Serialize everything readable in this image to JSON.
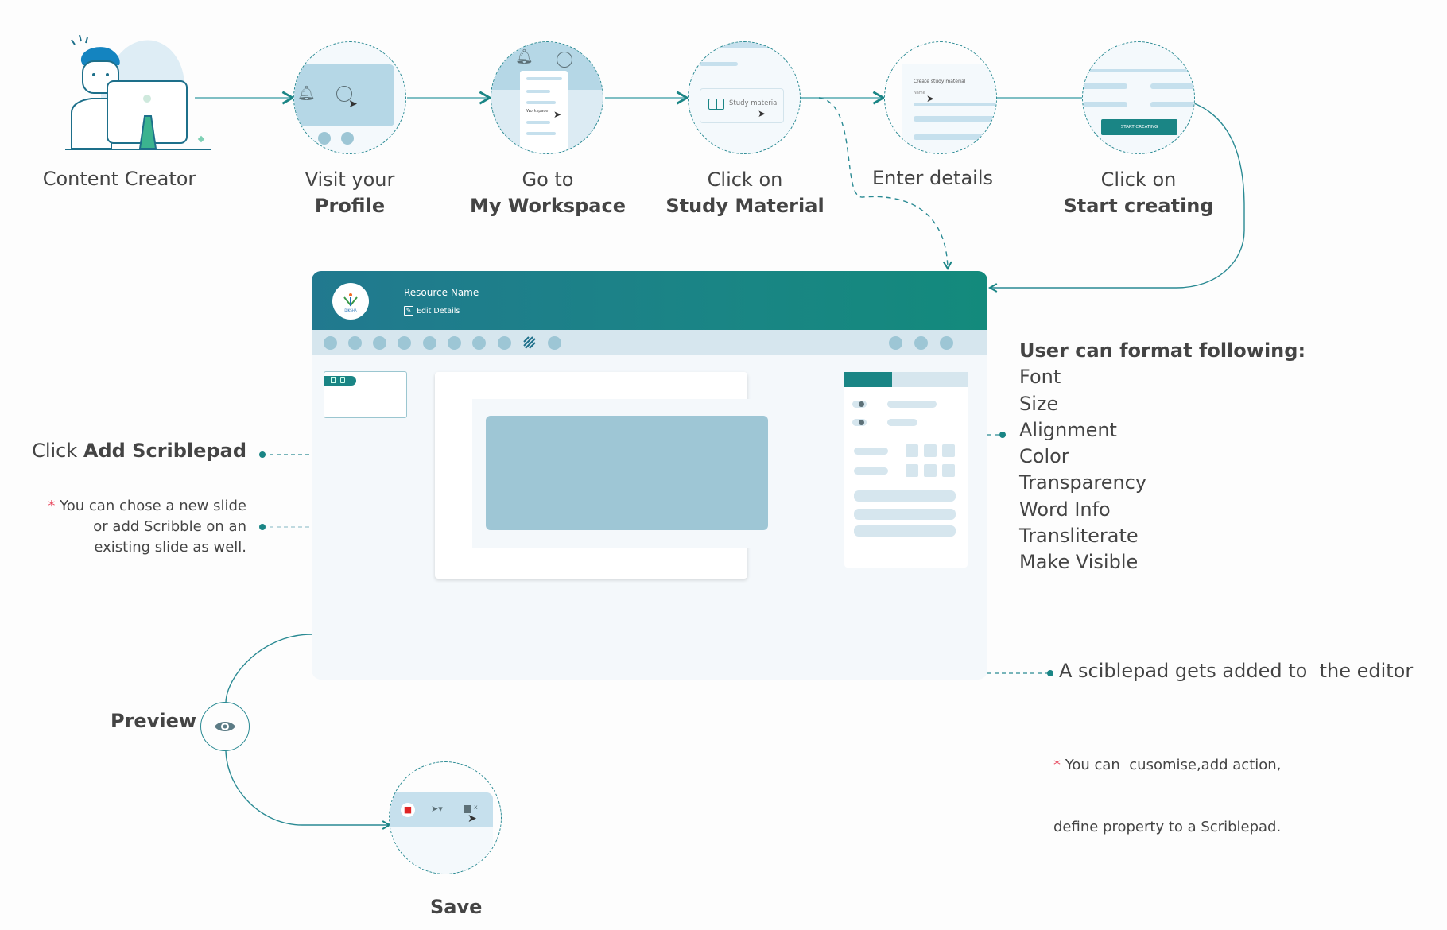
{
  "colors": {
    "accent_teal": "#1a8585",
    "header_gradient_start": "#21798f",
    "header_gradient_end": "#138a7c",
    "light_blue": "#9ec6d5",
    "pale_blue": "#d6e6ee",
    "asterisk_red": "#e84a5f",
    "text_dark": "#444444"
  },
  "steps": [
    {
      "id": "content-creator",
      "line1": "Content Creator",
      "line2": ""
    },
    {
      "id": "visit-profile",
      "line1": "Visit your",
      "line2": "Profile"
    },
    {
      "id": "my-workspace",
      "line1": "Go to",
      "line2": "My Workspace"
    },
    {
      "id": "study-material",
      "line1": "Click on",
      "line2": "Study Material"
    },
    {
      "id": "enter-details",
      "line1": "Enter details",
      "line2": ""
    },
    {
      "id": "start-creating",
      "line1": "Click on",
      "line2": "Start creating"
    }
  ],
  "step_thumbnails": {
    "workspace_menu_label": "Workspace",
    "study_material_button": "Study material",
    "create_form_title": "Create study material",
    "create_form_name_label": "Name",
    "start_creating_button": "START CREATING"
  },
  "editor": {
    "resource_name": "Resource Name",
    "edit_details": "Edit Details",
    "logo_text": "DIKSHA",
    "toolbar_left_icon_count": 10,
    "scribble_tool_index": 8,
    "toolbar_right_icon_count": 3
  },
  "annotations": {
    "add_scriblepad_prefix": "Click ",
    "add_scriblepad_bold": "Add Scriblepad",
    "slide_note_asterisk": "*",
    "slide_note_lines": [
      "You can chose a new slide",
      "or add Scribble on an",
      "existing slide as well."
    ],
    "scriblepad_added": "A sciblepad gets added to  the editor",
    "customise_note_asterisk": "*",
    "customise_note_lines": [
      "You can  cusomise,add action,",
      "define property to a Scriblepad."
    ]
  },
  "format_options": {
    "title": "User can format following:",
    "items": [
      "Font",
      "Size",
      "Alignment",
      "Color",
      "Transparency",
      "Word Info",
      "Transliterate",
      "Make Visible"
    ]
  },
  "final_steps": {
    "preview_label": "Preview",
    "save_label": "Save"
  }
}
